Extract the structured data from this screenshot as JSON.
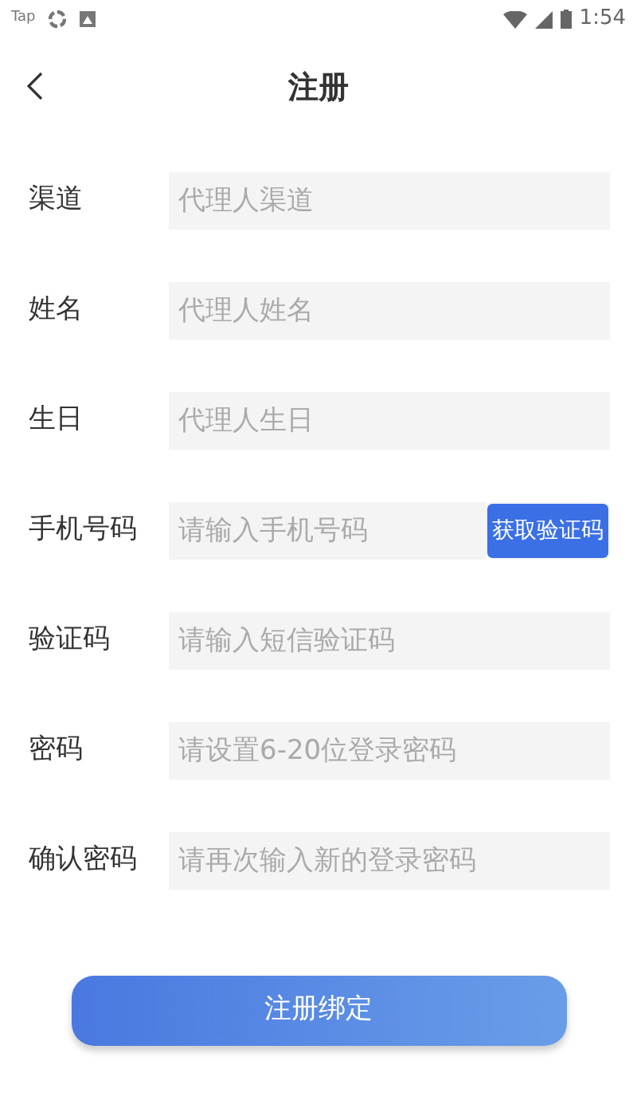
{
  "status_bar": {
    "app_label": "Tap",
    "time": "1:54"
  },
  "header": {
    "title": "注册"
  },
  "fields": [
    {
      "label": "渠道",
      "placeholder": "代理人渠道"
    },
    {
      "label": "姓名",
      "placeholder": "代理人姓名"
    },
    {
      "label": "生日",
      "placeholder": "代理人生日"
    },
    {
      "label": "手机号码",
      "placeholder": "请输入手机号码",
      "action": "获取验证码"
    },
    {
      "label": "验证码",
      "placeholder": "请输入短信验证码"
    },
    {
      "label": "密码",
      "placeholder": "请设置6-20位登录密码"
    },
    {
      "label": "确认密码",
      "placeholder": "请再次输入新的登录密码"
    }
  ],
  "submit": {
    "label": "注册绑定"
  }
}
